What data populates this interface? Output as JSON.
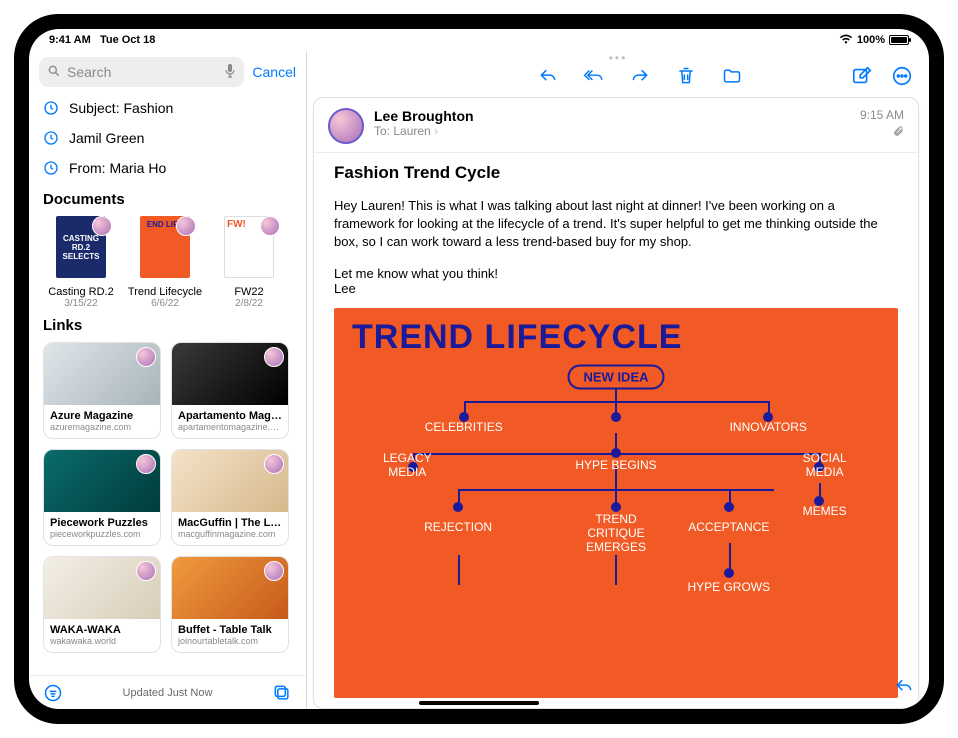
{
  "status": {
    "time": "9:41 AM",
    "date": "Tue Oct 18",
    "battery_pct": "100%"
  },
  "sidebar": {
    "search_placeholder": "Search",
    "cancel_label": "Cancel",
    "recent": [
      {
        "label": "Subject: Fashion"
      },
      {
        "label": "Jamil Green"
      },
      {
        "label": "From: Maria Ho"
      }
    ],
    "documents_header": "Documents",
    "documents": [
      {
        "label": "Casting RD.2",
        "date": "3/15/22",
        "thumb_bg": "#1b2a6b",
        "thumb_text": "CASTING RD.2 SELECTS"
      },
      {
        "label": "Trend Lifecycle",
        "date": "6/6/22",
        "thumb_bg": "#f15a24",
        "thumb_text": "END LIFE"
      },
      {
        "label": "FW22",
        "date": "2/8/22",
        "thumb_bg": "#ffffff",
        "thumb_text": "FW!"
      }
    ],
    "links_header": "Links",
    "links": [
      {
        "title": "Azure Magazine",
        "subtitle": "azuremagazine.com",
        "bg": "linear-gradient(135deg,#dfe6ea,#a8b4b9)"
      },
      {
        "title": "Apartamento Maga...",
        "subtitle": "apartamentomagazine.com",
        "bg": "linear-gradient(135deg,#3a3a3a,#000)"
      },
      {
        "title": "Piecework Puzzles",
        "subtitle": "pieceworkpuzzles.com",
        "bg": "linear-gradient(135deg,#0a6b6b,#013c3c)"
      },
      {
        "title": "MacGuffin | The Lif...",
        "subtitle": "macguffinmagazine.com",
        "bg": "linear-gradient(135deg,#f4e2c8,#d6b98c)"
      },
      {
        "title": "WAKA-WAKA",
        "subtitle": "wakawaka.world",
        "bg": "linear-gradient(135deg,#f3efe7,#d8cdb8)"
      },
      {
        "title": "Buffet - Table Talk",
        "subtitle": "joinourtabletalk.com",
        "bg": "linear-gradient(135deg,#f09a3e,#c75a1a)"
      }
    ],
    "footer_status": "Updated Just Now"
  },
  "message": {
    "sender": "Lee Broughton",
    "to_prefix": "To:",
    "to_name": "Lauren",
    "time": "9:15 AM",
    "subject": "Fashion Trend Cycle",
    "body_p1": "Hey Lauren! This is what I was talking about last night at dinner! I've been working on a framework for looking at the lifecycle of a trend. It's super helpful to get me thinking outside the box, so I can work toward a less trend-based buy for my shop.",
    "body_p2": "Let me know what you think!",
    "body_sign": "Lee",
    "attachment": {
      "title": "TREND LIFECYCLE",
      "nodes": {
        "new_idea": "NEW IDEA",
        "celebrities": "CELEBRITIES",
        "innovators": "INNOVATORS",
        "legacy_media": "LEGACY\nMEDIA",
        "hype_begins": "HYPE BEGINS",
        "social_media": "SOCIAL\nMEDIA",
        "memes": "MEMES",
        "rejection": "REJECTION",
        "trend_critique": "TREND\nCRITIQUE\nEMERGES",
        "acceptance": "ACCEPTANCE",
        "hype_grows": "HYPE GROWS"
      }
    }
  }
}
